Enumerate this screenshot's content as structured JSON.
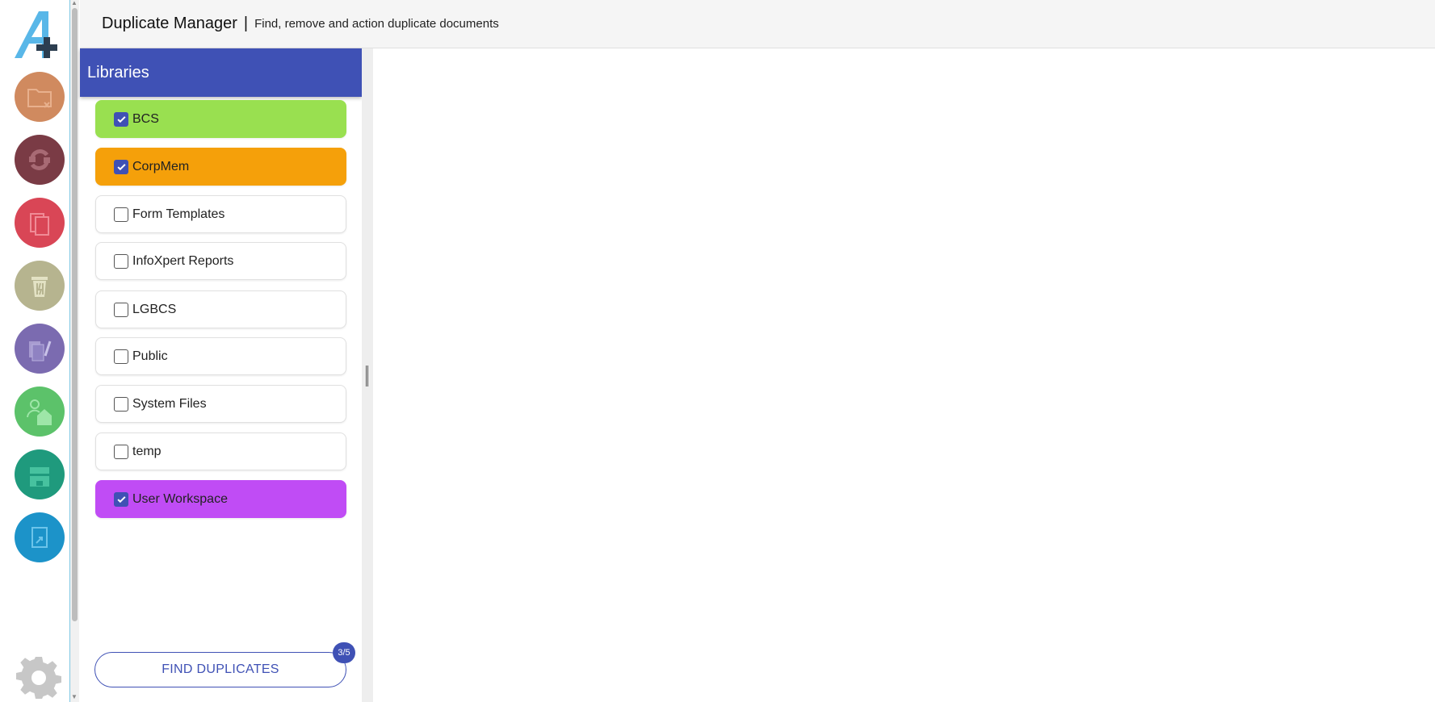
{
  "header": {
    "title": "Duplicate Manager",
    "separator": "|",
    "subtitle": "Find, remove and action duplicate documents"
  },
  "rail": {
    "apps": [
      {
        "icon": "folder-move-icon",
        "color": "#d08a5f"
      },
      {
        "icon": "sync-icon",
        "color": "#7a3b45"
      },
      {
        "icon": "duplicate-documents-icon",
        "color": "#d94656"
      },
      {
        "icon": "recycle-bin-icon",
        "color": "#b6b48f"
      },
      {
        "icon": "edit-documents-icon",
        "color": "#7b6bb0"
      },
      {
        "icon": "user-home-icon",
        "color": "#5cc26a"
      },
      {
        "icon": "archive-box-icon",
        "color": "#1f9a7d"
      },
      {
        "icon": "document-link-icon",
        "color": "#1c93c9"
      }
    ]
  },
  "libraries": {
    "heading": "Libraries",
    "items": [
      {
        "label": "BCS",
        "checked": true,
        "color": "#99e050"
      },
      {
        "label": "CorpMem",
        "checked": true,
        "color": "#f5a00a"
      },
      {
        "label": "Form Templates",
        "checked": false,
        "color": "#ffffff"
      },
      {
        "label": "InfoXpert Reports",
        "checked": false,
        "color": "#ffffff"
      },
      {
        "label": "LGBCS",
        "checked": false,
        "color": "#ffffff"
      },
      {
        "label": "Public",
        "checked": false,
        "color": "#ffffff"
      },
      {
        "label": "System Files",
        "checked": false,
        "color": "#ffffff"
      },
      {
        "label": "temp",
        "checked": false,
        "color": "#ffffff"
      },
      {
        "label": "User Workspace",
        "checked": true,
        "color": "#c04cf5"
      }
    ],
    "find_button": "FIND DUPLICATES",
    "selected_badge": "3/5"
  },
  "colors": {
    "accent": "#3f51b5"
  }
}
